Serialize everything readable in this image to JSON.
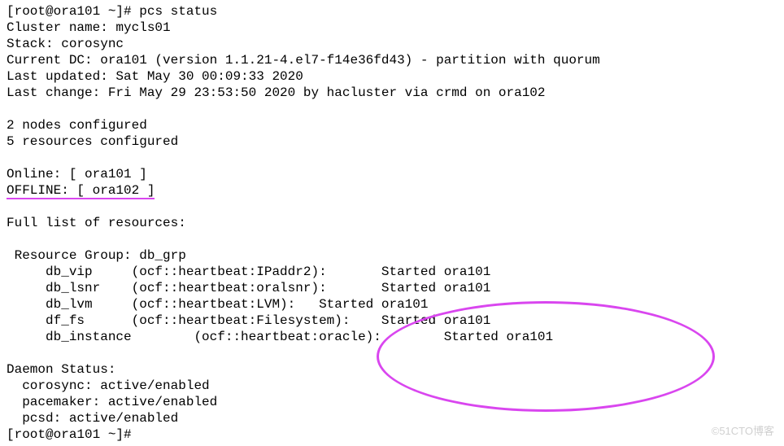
{
  "prompt1": "[root@ora101 ~]# ",
  "cmd": "pcs status",
  "line_cluster_name": "Cluster name: mycls01",
  "line_stack": "Stack: corosync",
  "line_current_dc": "Current DC: ora101 (version 1.1.21-4.el7-f14e36fd43) - partition with quorum",
  "line_last_updated": "Last updated: Sat May 30 00:09:33 2020",
  "line_last_change": "Last change: Fri May 29 23:53:50 2020 by hacluster via crmd on ora102",
  "line_nodes": "2 nodes configured",
  "line_resources": "5 resources configured",
  "line_online": "Online: [ ora101 ]",
  "line_offline": "OFFLINE: [ ora102 ]",
  "line_full_list": "Full list of resources:",
  "line_group": " Resource Group: db_grp",
  "line_vip": "     db_vip     (ocf::heartbeat:IPaddr2):       Started ora101",
  "line_lsnr": "     db_lsnr    (ocf::heartbeat:oralsnr):       Started ora101",
  "line_lvm": "     db_lvm     (ocf::heartbeat:LVM):   Started ora101",
  "line_fs": "     df_fs      (ocf::heartbeat:Filesystem):    Started ora101",
  "line_inst": "     db_instance        (ocf::heartbeat:oracle):        Started ora101",
  "line_daemon": "Daemon Status:",
  "line_corosync": "  corosync: active/enabled",
  "line_pacemaker": "  pacemaker: active/enabled",
  "line_pcsd": "  pcsd: active/enabled",
  "prompt2": "[root@ora101 ~]# ",
  "watermark": "©51CTO博客",
  "cluster": {
    "name": "mycls01",
    "stack": "corosync",
    "current_dc": "ora101",
    "version": "1.1.21-4.el7-f14e36fd43",
    "partition": "partition with quorum",
    "last_updated": "Sat May 30 00:09:33 2020",
    "last_change": "Fri May 29 23:53:50 2020 by hacluster via crmd on ora102",
    "nodes_configured": 2,
    "resources_configured": 5,
    "online": [
      "ora101"
    ],
    "offline": [
      "ora102"
    ]
  },
  "resource_group": {
    "name": "db_grp",
    "resources": [
      {
        "id": "db_vip",
        "agent": "ocf::heartbeat:IPaddr2",
        "state": "Started",
        "node": "ora101"
      },
      {
        "id": "db_lsnr",
        "agent": "ocf::heartbeat:oralsnr",
        "state": "Started",
        "node": "ora101"
      },
      {
        "id": "db_lvm",
        "agent": "ocf::heartbeat:LVM",
        "state": "Started",
        "node": "ora101"
      },
      {
        "id": "df_fs",
        "agent": "ocf::heartbeat:Filesystem",
        "state": "Started",
        "node": "ora101"
      },
      {
        "id": "db_instance",
        "agent": "ocf::heartbeat:oracle",
        "state": "Started",
        "node": "ora101"
      }
    ]
  },
  "daemons": [
    {
      "name": "corosync",
      "status": "active/enabled"
    },
    {
      "name": "pacemaker",
      "status": "active/enabled"
    },
    {
      "name": "pcsd",
      "status": "active/enabled"
    }
  ]
}
